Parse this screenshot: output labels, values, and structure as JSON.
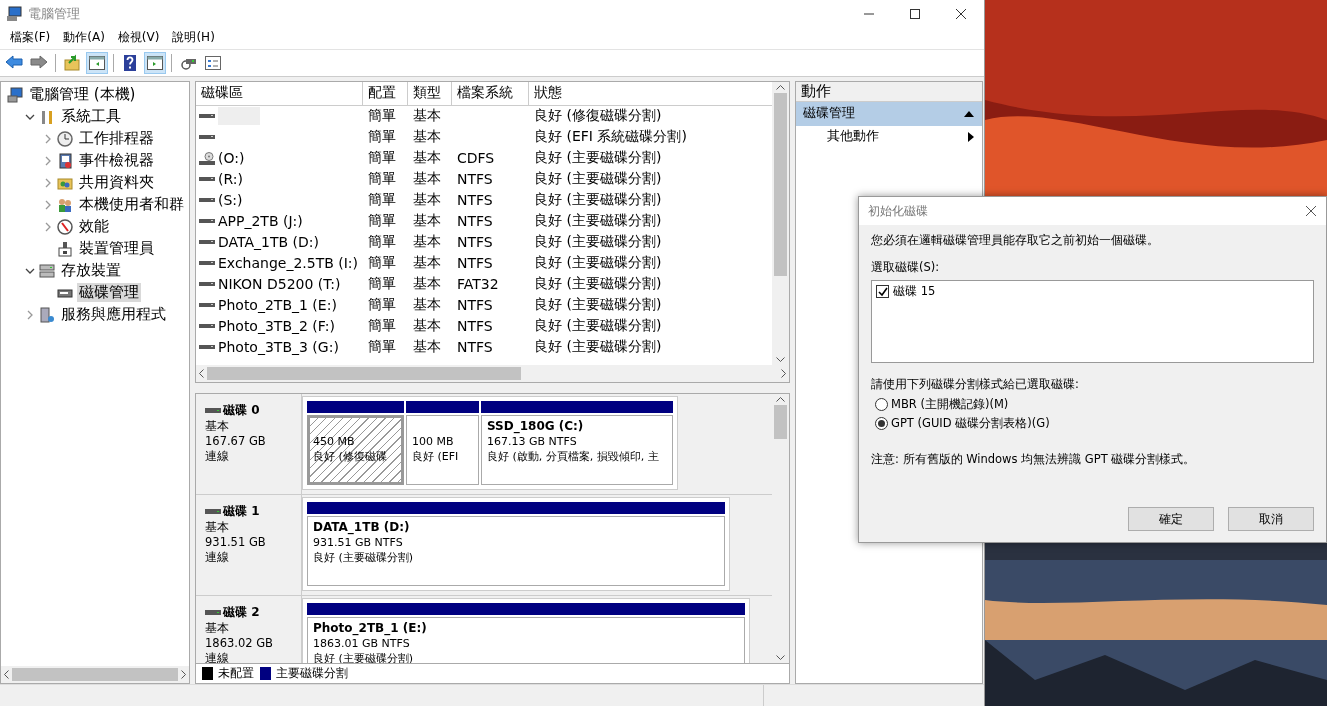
{
  "window": {
    "title": "電腦管理",
    "controls": [
      {
        "kind": "minimize"
      },
      {
        "kind": "maximize"
      },
      {
        "kind": "close"
      }
    ]
  },
  "menu": [
    "檔案(F)",
    "動作(A)",
    "檢視(V)",
    "說明(H)"
  ],
  "toolbar": [
    [
      {
        "kind": "back",
        "pressed": false
      },
      {
        "kind": "forward",
        "pressed": false
      }
    ],
    [
      {
        "kind": "up",
        "pressed": false
      },
      {
        "kind": "tree-toggle",
        "pressed": true
      }
    ],
    [
      {
        "kind": "help",
        "pressed": false
      },
      {
        "kind": "pane-toggle",
        "pressed": true
      }
    ],
    [
      {
        "kind": "connect",
        "pressed": false
      },
      {
        "kind": "properties",
        "pressed": false
      }
    ]
  ],
  "tree": [
    {
      "label": "電腦管理 (本機)",
      "kind": "computer",
      "selected": false,
      "children": [
        {
          "label": "系統工具",
          "kind": "tools",
          "expanded": true,
          "selected": false,
          "children": [
            {
              "label": "工作排程器",
              "kind": "clock",
              "expanded": false,
              "selected": false
            },
            {
              "label": "事件檢視器",
              "kind": "log",
              "expanded": false,
              "selected": false
            },
            {
              "label": "共用資料夾",
              "kind": "folder",
              "expanded": false,
              "selected": false
            },
            {
              "label": "本機使用者和群",
              "kind": "users",
              "expanded": false,
              "selected": false
            },
            {
              "label": "效能",
              "kind": "gauge",
              "expanded": false,
              "selected": false
            },
            {
              "label": "裝置管理員",
              "kind": "device",
              "selected": false
            }
          ]
        },
        {
          "label": "存放裝置",
          "kind": "storage",
          "expanded": true,
          "selected": false,
          "children": [
            {
              "label": "磁碟管理",
              "kind": "disk",
              "selected": true
            }
          ]
        },
        {
          "label": "服務與應用程式",
          "kind": "services",
          "expanded": false,
          "selected": false
        }
      ]
    }
  ],
  "table": {
    "columns": [
      "磁碟區",
      "配置",
      "類型",
      "檔案系統",
      "狀態"
    ],
    "rows": [
      {
        "kind": "drive",
        "masked": true,
        "layout": "簡單",
        "type": "基本",
        "status": "良好 (修復磁碟分割)"
      },
      {
        "kind": "drive",
        "masked": false,
        "layout": "簡單",
        "type": "基本",
        "status": "良好 (EFI 系統磁碟分割)"
      },
      {
        "kind": "cd",
        "masked": false,
        "volume": " (O:)",
        "layout": "簡單",
        "type": "基本",
        "file_system": "CDFS",
        "status": "良好 (主要磁碟分割)"
      },
      {
        "kind": "drive",
        "masked": false,
        "volume": " (R:)",
        "layout": "簡單",
        "type": "基本",
        "file_system": "NTFS",
        "status": "良好 (主要磁碟分割)"
      },
      {
        "kind": "drive",
        "masked": false,
        "volume": " (S:)",
        "layout": "簡單",
        "type": "基本",
        "file_system": "NTFS",
        "status": "良好 (主要磁碟分割)"
      },
      {
        "kind": "drive",
        "masked": false,
        "volume": "APP_2TB (J:)",
        "layout": "簡單",
        "type": "基本",
        "file_system": "NTFS",
        "status": "良好 (主要磁碟分割)"
      },
      {
        "kind": "drive",
        "masked": false,
        "volume": "DATA_1TB (D:)",
        "layout": "簡單",
        "type": "基本",
        "file_system": "NTFS",
        "status": "良好 (主要磁碟分割)"
      },
      {
        "kind": "drive",
        "masked": false,
        "volume": "Exchange_2.5TB (I:)",
        "layout": "簡單",
        "type": "基本",
        "file_system": "NTFS",
        "status": "良好 (主要磁碟分割)"
      },
      {
        "kind": "drive",
        "masked": false,
        "volume": "NIKON D5200 (T:)",
        "layout": "簡單",
        "type": "基本",
        "file_system": "FAT32",
        "status": "良好 (主要磁碟分割)"
      },
      {
        "kind": "drive",
        "masked": false,
        "volume": "Photo_2TB_1 (E:)",
        "layout": "簡單",
        "type": "基本",
        "file_system": "NTFS",
        "status": "良好 (主要磁碟分割)"
      },
      {
        "kind": "drive",
        "masked": false,
        "volume": "Photo_3TB_2 (F:)",
        "layout": "簡單",
        "type": "基本",
        "file_system": "NTFS",
        "status": "良好 (主要磁碟分割)"
      },
      {
        "kind": "drive",
        "masked": false,
        "volume": "Photo_3TB_3 (G:)",
        "layout": "簡單",
        "type": "基本",
        "file_system": "NTFS",
        "status": "良好 (主要磁碟分割)"
      }
    ]
  },
  "disks": [
    {
      "name": "磁碟 0",
      "type": "基本",
      "size": "167.67 GB",
      "status": "連線",
      "partitions": [
        {
          "size": "450 MB",
          "status": "良好 (修復磁碟",
          "selected": true
        },
        {
          "size": "100 MB",
          "status": "良好 (EFI",
          "selected": false
        },
        {
          "label": "SSD_180G  (C:)",
          "size": "167.13 GB NTFS",
          "status": "良好 (啟動, 分頁檔案, 損毀傾印, 主",
          "selected": false
        }
      ]
    },
    {
      "name": "磁碟 1",
      "type": "基本",
      "size": "931.51 GB",
      "status": "連線",
      "partitions": [
        {
          "label": "DATA_1TB  (D:)",
          "size": "931.51 GB NTFS",
          "status": "良好 (主要磁碟分割)",
          "selected": false
        }
      ]
    },
    {
      "name": "磁碟 2",
      "type": "基本",
      "size": "1863.02 GB",
      "status": "連線",
      "partitions": [
        {
          "label": "Photo_2TB_1  (E:)",
          "size": "1863.01 GB NTFS",
          "status": "良好 (主要磁碟分割)",
          "selected": false
        }
      ]
    }
  ],
  "legend": [
    {
      "label": "未配置",
      "color": "#000000"
    },
    {
      "label": "主要磁碟分割",
      "color": "#000080"
    }
  ],
  "actions": {
    "title": "動作",
    "sections": [
      {
        "label": "磁碟管理",
        "expanded": true,
        "items": [
          "其他動作"
        ]
      }
    ]
  },
  "dialog": {
    "title": "初始化磁碟",
    "message": "您必須在邏輯磁碟管理員能存取它之前初始一個磁碟。",
    "disk_list_label": "選取磁碟(S):",
    "disks": [
      {
        "label": "磁碟 15",
        "checked": true
      }
    ],
    "style_label": "請使用下列磁碟分割樣式給已選取磁碟:",
    "styles": [
      {
        "label": "MBR (主開機記錄)(M)",
        "selected": false
      },
      {
        "label": "GPT (GUID 磁碟分割表格)(G)",
        "selected": true
      }
    ],
    "note": "注意: 所有舊版的 Windows 均無法辨識 GPT 磁碟分割樣式。",
    "buttons": [
      "確定",
      "取消"
    ]
  }
}
